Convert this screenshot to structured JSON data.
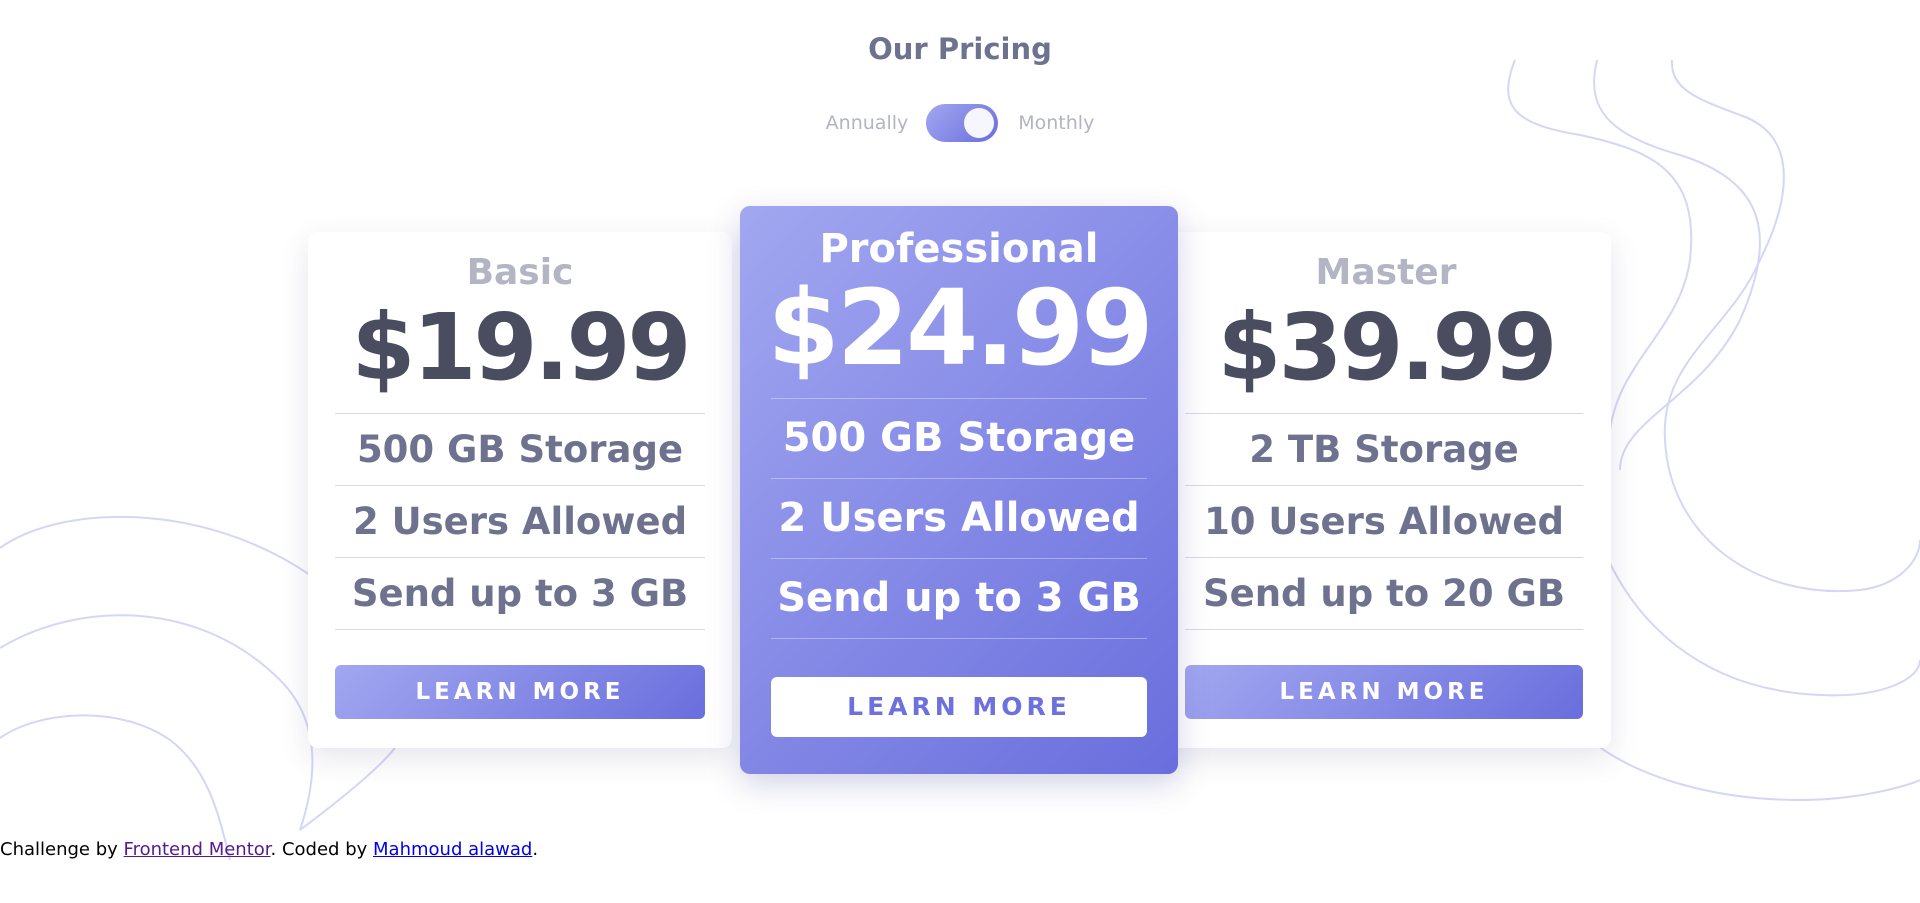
{
  "header": {
    "title": "Our Pricing"
  },
  "billing_toggle": {
    "left_label": "Annually",
    "right_label": "Monthly"
  },
  "plans": [
    {
      "name": "Basic",
      "price": "$19.99",
      "features": [
        "500 GB Storage",
        "2 Users Allowed",
        "Send up to 3 GB"
      ],
      "button_label": "LEARN MORE"
    },
    {
      "name": "Professional",
      "price": "$24.99",
      "features": [
        "500 GB Storage",
        "2 Users Allowed",
        "Send up to 3 GB"
      ],
      "button_label": "LEARN MORE"
    },
    {
      "name": "Master",
      "price": "$39.99",
      "features": [
        "2 TB Storage",
        "10 Users Allowed",
        "Send up to 20 GB"
      ],
      "button_label": "LEARN MORE"
    }
  ],
  "footer": {
    "prefix": "Challenge by",
    "link1": "Frontend Mentor",
    "middle": ". Coded by",
    "link2": "Mahmoud alawad",
    "suffix": "."
  },
  "colors": {
    "accent_start": "#a2a7f0",
    "accent_end": "#696edd",
    "text_dark": "#4a4d60",
    "text_muted": "#6e728e"
  }
}
